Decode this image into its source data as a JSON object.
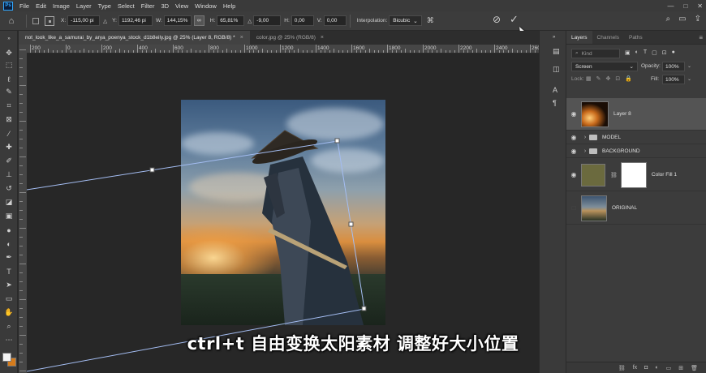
{
  "menubar": {
    "app_logo": "Ps",
    "items": [
      "File",
      "Edit",
      "Image",
      "Layer",
      "Type",
      "Select",
      "Filter",
      "3D",
      "View",
      "Window",
      "Help"
    ],
    "window_controls": [
      "—",
      "□",
      "✕"
    ]
  },
  "options": {
    "x_label": "X:",
    "x_value": "-115,00 pi",
    "y_label": "Y:",
    "y_value": "1192,46 pi",
    "w_label": "W:",
    "w_value": "144,15%",
    "h_label": "H:",
    "h_value": "65,81%",
    "angle_label": "△",
    "angle_value": "-9,00",
    "hskew_label": "H:",
    "hskew_value": "0,00",
    "vskew_label": "V:",
    "vskew_value": "0,00",
    "interpolation_label": "Interpolation:",
    "interpolation_value": "Bicubic",
    "cancel_glyph": "⊘",
    "commit_glyph": "✓"
  },
  "tabs": [
    {
      "label": "not_look_like_a_samurai_by_arya_poenya_stock_d1b8eily.jpg @ 25% (Layer 8, RGB/8) *",
      "close": "×"
    },
    {
      "label": "color.jpg @ 25% (RGB/8)",
      "close": "×"
    }
  ],
  "ruler": {
    "ticks": [
      "200",
      "0",
      "200",
      "400",
      "600",
      "800",
      "1000",
      "1200",
      "1400",
      "1600",
      "1800",
      "2000",
      "2200",
      "2400",
      "2600"
    ]
  },
  "layers_panel": {
    "tabs": [
      "Layers",
      "Channels",
      "Paths"
    ],
    "menu_glyph": "≡",
    "kind_label": "Kind",
    "blend_mode": "Screen",
    "opacity_label": "Opacity:",
    "opacity_value": "100%",
    "lock_label": "Lock:",
    "fill_label": "Fill:",
    "fill_value": "100%",
    "layers": [
      {
        "name": "Layer 8",
        "type": "image",
        "visible": true,
        "selected": true
      },
      {
        "name": "MODEL",
        "type": "group",
        "visible": true,
        "selected": false
      },
      {
        "name": "BACKGROUND",
        "type": "group",
        "visible": true,
        "selected": false
      },
      {
        "name": "Color Fill 1",
        "type": "fill",
        "visible": true,
        "selected": false
      },
      {
        "name": "ORIGINAL",
        "type": "image",
        "visible": false,
        "selected": false
      }
    ],
    "bottom_icons": [
      "link-icon",
      "fx-icon",
      "mask-icon",
      "adjustment-icon",
      "folder-icon",
      "new-layer-icon",
      "trash-icon"
    ]
  },
  "colors": {
    "foreground": "#f4f4f4",
    "background": "#d57b1b",
    "fill_layer": "#6b6a3e",
    "transform_line": "#a4bdf2"
  },
  "subtitle": "ctrl+t 自由变换太阳素材 调整好大小位置"
}
